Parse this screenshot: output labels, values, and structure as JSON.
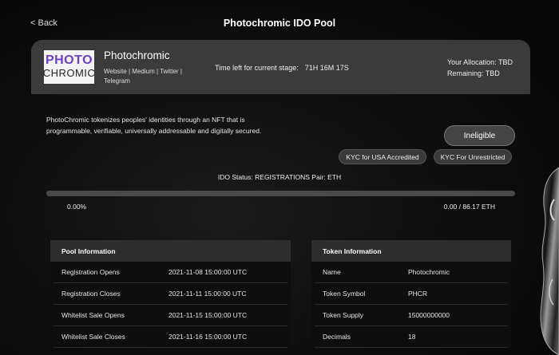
{
  "header": {
    "back_label": "< Back",
    "title": "Photochromic IDO Pool"
  },
  "project": {
    "logo_line1": "PHOTO",
    "logo_line2": "CHROMIC",
    "name": "Photochromic",
    "links": [
      "Website",
      "Medium",
      "Twitter",
      "Telegram"
    ],
    "time_left_label": "Time left for current stage:",
    "time_left_value": "71H 16M 17S",
    "allocation": "Your Allocation: TBD",
    "remaining": "Remaining: TBD",
    "description": "PhotoChromic tokenizes peoples' identities through an NFT that is programmable, verifiable, universally addressable and digitally secured."
  },
  "actions": {
    "ineligible_label": "Ineligible",
    "kyc_usa_label": "KYC for USA Accredited",
    "kyc_unrestricted_label": "KYC For Unrestricted"
  },
  "status": {
    "text": "IDO Status: REGISTRATIONS Pair: ETH",
    "progress_fraction": 0.0,
    "percent_label": "0.00%",
    "raised_label": "0.00 / 86.17 ETH"
  },
  "pool_info": {
    "title": "Pool Information",
    "rows": [
      {
        "label": "Registration Opens",
        "value": "2021-11-08 15:00:00 UTC"
      },
      {
        "label": "Registration Closes",
        "value": "2021-11-11 15:00:00 UTC"
      },
      {
        "label": "Whitelist Sale Opens",
        "value": "2021-11-15 15:00:00 UTC"
      },
      {
        "label": "Whitelist Sale Closes",
        "value": "2021-11-16 15:00:00 UTC"
      }
    ]
  },
  "token_info": {
    "title": "Token Information",
    "rows": [
      {
        "label": "Name",
        "value": "Photochromic"
      },
      {
        "label": "Token Symbol",
        "value": "PHCR"
      },
      {
        "label": "Token Supply",
        "value": "15000000000"
      },
      {
        "label": "Decimals",
        "value": "18"
      }
    ]
  },
  "colors": {
    "background": "#0d0d0d",
    "card": "#3b3b3b",
    "logo_accent": "#6a3fc7"
  }
}
